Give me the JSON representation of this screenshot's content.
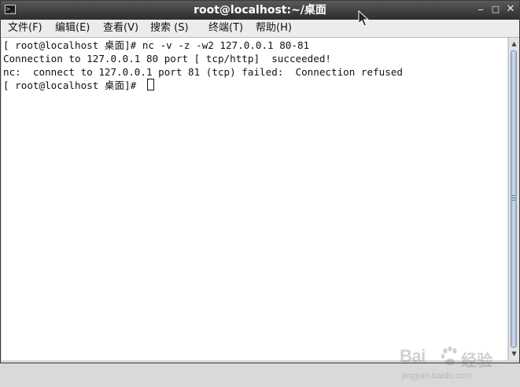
{
  "window": {
    "title": "root@localhost:~/桌面",
    "icon": "terminal-icon"
  },
  "window_controls": {
    "minimize": "‒",
    "maximize": "□",
    "close": "✕"
  },
  "menu": {
    "items": [
      "文件(F)",
      "编辑(E)",
      "查看(V)",
      "搜索 (S)",
      "终端(T)",
      "帮助(H)"
    ]
  },
  "terminal": {
    "lines": [
      "[ root@localhost 桌面]# nc -v -z -w2 127.0.0.1 80-81",
      "Connection to 127.0.0.1 80 port [ tcp/http]  succeeded!",
      "nc:  connect to 127.0.0.1 port 81 (tcp) failed:  Connection refused",
      "[ root@localhost 桌面]# "
    ],
    "background": "#ffffff",
    "foreground": "#111111"
  },
  "watermark": {
    "brand": "Bai",
    "brand_cn": "经验",
    "url": "jingyan.baidu.com"
  }
}
